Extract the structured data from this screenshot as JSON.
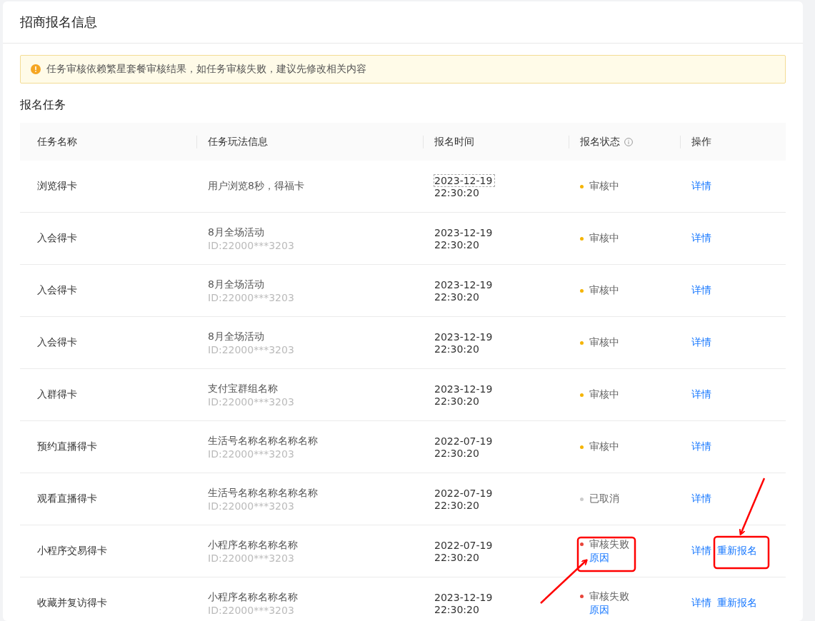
{
  "page": {
    "title": "招商报名信息"
  },
  "alert": {
    "text": "任务审核依赖繁星套餐审核结果，如任务审核失败，建议先修改相关内容"
  },
  "section": {
    "title": "报名任务"
  },
  "table": {
    "columns": [
      {
        "label": "任务名称",
        "info": false
      },
      {
        "label": "任务玩法信息",
        "info": false
      },
      {
        "label": "报名时间",
        "info": false
      },
      {
        "label": "报名状态",
        "info": true
      },
      {
        "label": "操作",
        "info": false
      }
    ],
    "rows": [
      {
        "name": "浏览得卡",
        "info": "用户浏览8秒，得福卡",
        "date": "2023-12-19",
        "time": "22:30:20",
        "focused": true,
        "status": "审核中",
        "color": "#f5b400",
        "actions": [
          "详情"
        ]
      },
      {
        "name": "入会得卡",
        "info": "8月全场活动",
        "id": "ID:22000***3203",
        "date": "2023-12-19",
        "time": "22:30:20",
        "focused": false,
        "status": "审核中",
        "color": "#f5b400",
        "actions": [
          "详情"
        ]
      },
      {
        "name": "入会得卡",
        "info": "8月全场活动",
        "id": "ID:22000***3203",
        "date": "2023-12-19",
        "time": "22:30:20",
        "focused": false,
        "status": "审核中",
        "color": "#f5b400",
        "actions": [
          "详情"
        ]
      },
      {
        "name": "入会得卡",
        "info": "8月全场活动",
        "id": "ID:22000***3203",
        "date": "2023-12-19",
        "time": "22:30:20",
        "focused": false,
        "status": "审核中",
        "color": "#f5b400",
        "actions": [
          "详情"
        ]
      },
      {
        "name": "入群得卡",
        "info": "支付宝群组名称",
        "id": "ID:22000***3203",
        "date": "2023-12-19",
        "time": "22:30:20",
        "focused": false,
        "status": "审核中",
        "color": "#f5b400",
        "actions": [
          "详情"
        ]
      },
      {
        "name": "预约直播得卡",
        "info": "生活号名称名称名称名称",
        "id": "ID:22000***3203",
        "date": "2022-07-19",
        "time": "22:30:20",
        "focused": false,
        "status": "审核中",
        "color": "#f5b400",
        "actions": [
          "详情"
        ]
      },
      {
        "name": "观看直播得卡",
        "info": "生活号名称名称名称名称",
        "id": "ID:22000***3203",
        "date": "2022-07-19",
        "time": "22:30:20",
        "focused": false,
        "status": "已取消",
        "color": "#cccccc",
        "actions": [
          "详情"
        ]
      },
      {
        "name": "小程序交易得卡",
        "info": "小程序名称名称名称",
        "id": "ID:22000***3203",
        "date": "2022-07-19",
        "time": "22:30:20",
        "focused": false,
        "status": "审核失败",
        "color": "#e8443a",
        "reason": "原因",
        "actions": [
          "详情",
          "重新报名"
        ]
      },
      {
        "name": "收藏并复访得卡",
        "info": "小程序名称名称名称",
        "id": "ID:22000***3203",
        "date": "2023-12-19",
        "time": "22:30:20",
        "focused": false,
        "status": "审核失败",
        "color": "#e8443a",
        "reason": "原因",
        "actions": [
          "详情",
          "重新报名"
        ]
      }
    ]
  }
}
